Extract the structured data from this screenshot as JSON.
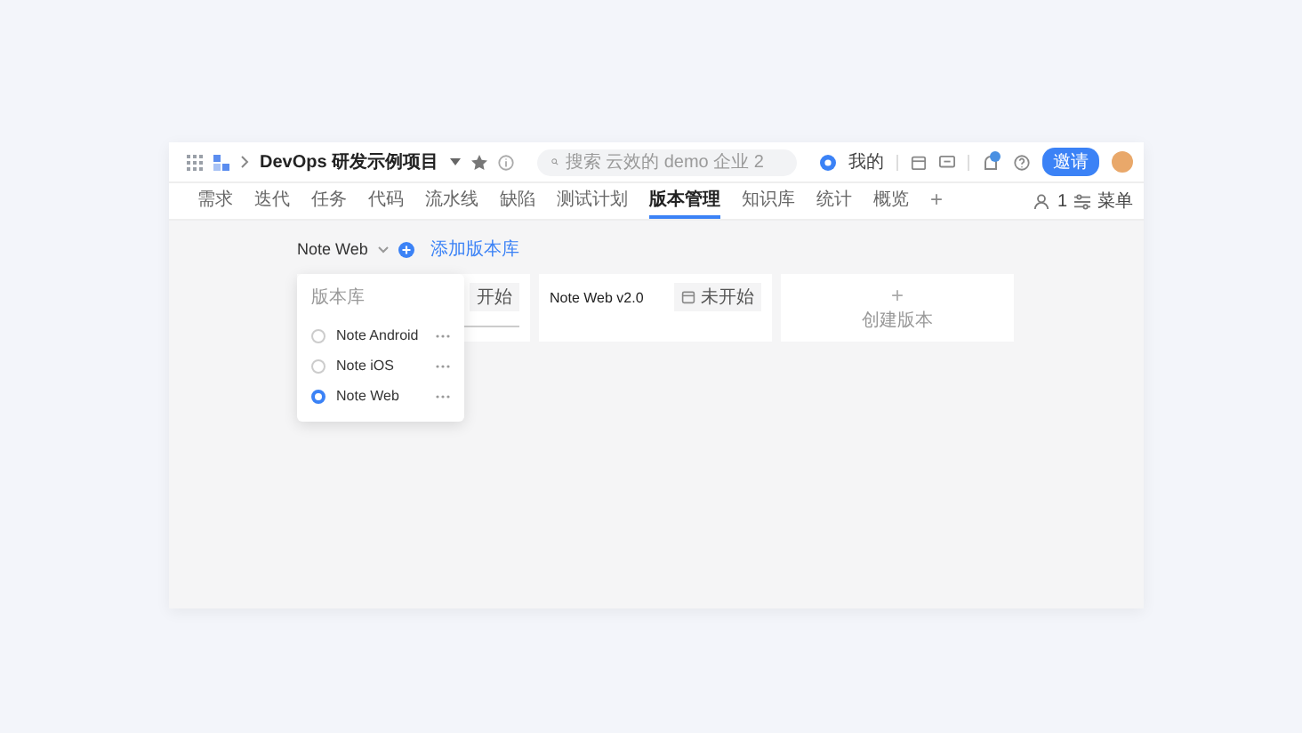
{
  "header": {
    "project": "DevOps 研发示例项目",
    "search": {
      "placeholder": "搜索 云效的 demo 企业 2"
    },
    "my_label": "我的",
    "invite_button": "邀请"
  },
  "tabs": [
    {
      "label": "需求",
      "selected": false
    },
    {
      "label": "迭代",
      "selected": false
    },
    {
      "label": "任务",
      "selected": false
    },
    {
      "label": "代码",
      "selected": false
    },
    {
      "label": "流水线",
      "selected": false
    },
    {
      "label": "缺陷",
      "selected": false
    },
    {
      "label": "测试计划",
      "selected": false
    },
    {
      "label": "版本管理",
      "selected": true
    },
    {
      "label": "知识库",
      "selected": false
    },
    {
      "label": "统计",
      "selected": false
    },
    {
      "label": "概览",
      "selected": false
    }
  ],
  "add_tab": "+",
  "members_count": "1",
  "menu_label": "菜单",
  "repo_selector": {
    "value": "Note Web",
    "add_label": "添加版本库"
  },
  "dropdown": {
    "title": "版本库",
    "items": [
      {
        "name": "Note Android",
        "selected": false
      },
      {
        "name": "Note iOS",
        "selected": false
      },
      {
        "name": "Note Web",
        "selected": true
      }
    ]
  },
  "versions": [
    {
      "kind": "version",
      "status": "开始"
    },
    {
      "kind": "version",
      "name": "Note Web v2.0",
      "status": "未开始"
    },
    {
      "kind": "create",
      "plus": "+",
      "label": "创建版本"
    }
  ]
}
